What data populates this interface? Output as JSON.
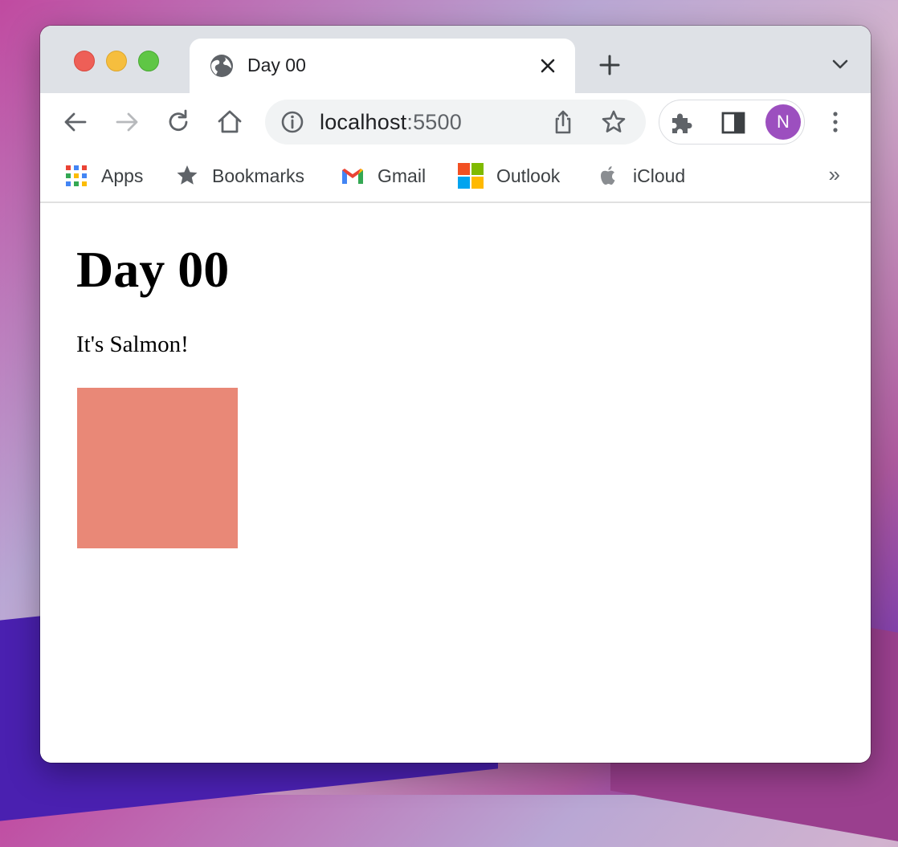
{
  "browser": {
    "tab": {
      "title": "Day 00"
    },
    "address": {
      "host": "localhost",
      "port": ":5500"
    },
    "profile": {
      "initial": "N",
      "color": "#9c4fbf"
    }
  },
  "bookmarks": {
    "items": [
      {
        "label": "Apps",
        "icon": "apps-grid-icon"
      },
      {
        "label": "Bookmarks",
        "icon": "star-icon"
      },
      {
        "label": "Gmail",
        "icon": "gmail-icon"
      },
      {
        "label": "Outlook",
        "icon": "outlook-icon"
      },
      {
        "label": "iCloud",
        "icon": "apple-icon"
      }
    ],
    "overflow": "»"
  },
  "page": {
    "heading": "Day 00",
    "text": "It's Salmon!",
    "swatch_color": "#e98877"
  }
}
